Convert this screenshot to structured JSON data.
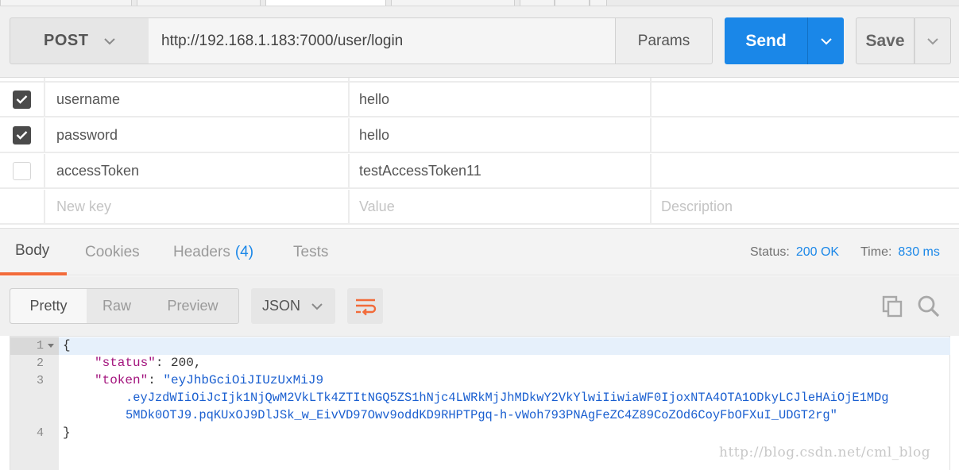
{
  "request": {
    "method": "POST",
    "url": "http://192.168.1.183:7000/user/login",
    "params_label": "Params",
    "send_label": "Send",
    "save_label": "Save"
  },
  "params": [
    {
      "checked": true,
      "key": "username",
      "value": "hello"
    },
    {
      "checked": true,
      "key": "password",
      "value": "hello"
    },
    {
      "checked": false,
      "key": "accessToken",
      "value": "testAccessToken11"
    }
  ],
  "new_row": {
    "key_placeholder": "New key",
    "value_placeholder": "Value",
    "description_placeholder": "Description"
  },
  "response_tabs": {
    "body": "Body",
    "cookies": "Cookies",
    "headers": "Headers",
    "headers_count": "(4)",
    "tests": "Tests"
  },
  "response_status": {
    "status_label": "Status:",
    "status_value": "200 OK",
    "time_label": "Time:",
    "time_value": "830 ms"
  },
  "body_view": {
    "pretty": "Pretty",
    "raw": "Raw",
    "preview": "Preview",
    "format": "JSON"
  },
  "code": {
    "line_numbers": [
      "1",
      "2",
      "3",
      "4"
    ],
    "open_brace": "{",
    "close_brace": "}",
    "status_key": "\"status\"",
    "status_value": "200",
    "token_key": "\"token\"",
    "token_line1": "\"eyJhbGciOiJIUzUxMiJ9",
    "token_line2": ".eyJzdWIiOiJcIjk1NjQwM2VkLTk4ZTItNGQ5ZS1hNjc4LWRkMjJhMDkwY2VkYlwiIiwiaWF0IjoxNTA4OTA1ODkyLCJleHAiOjE1MDg",
    "token_line3": "5MDk0OTJ9.pqKUxOJ9DlJSk_w_EivVD97Owv9oddKD9RHPTPgq-h-vWoh793PNAgFeZC4Z89CoZOd6CoyFbOFXuI_UDGT2rg\""
  },
  "watermark": "http://blog.csdn.net/cml_blog",
  "colors": {
    "accent_blue": "#1a87e8",
    "tab_underline": "#f26b3a",
    "json_key": "#a3157e",
    "json_string": "#1a5fd0"
  }
}
